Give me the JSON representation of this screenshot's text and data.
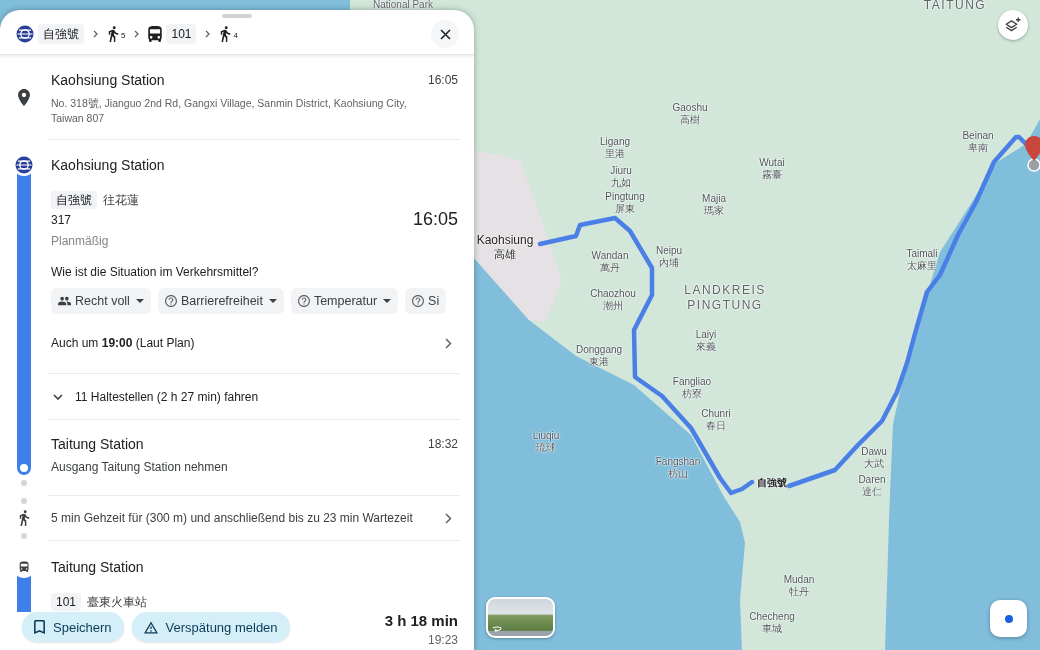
{
  "header": {
    "steps": [
      {
        "kind": "train",
        "label": "自強號"
      },
      {
        "kind": "walk",
        "minutes": "5"
      },
      {
        "kind": "bus",
        "label": "101"
      },
      {
        "kind": "walk",
        "minutes": "4"
      }
    ]
  },
  "origin": {
    "name": "Kaohsiung Station",
    "time": "16:05",
    "address": "No. 318號, Jianguo 2nd Rd, Gangxi Village, Sanmin District, Kaohsiung City, Taiwan 807"
  },
  "transit_leg": {
    "stop": "Kaohsiung Station",
    "line": "自強號",
    "direction": "往花蓮",
    "number": "317",
    "departure": "16:05",
    "status": "Planmäßig",
    "question": "Wie ist die Situation im Verkehrsmittel?",
    "chips": [
      {
        "kind": "crowd",
        "label": "Recht voll"
      },
      {
        "kind": "unknown",
        "label": "Barrierefreiheit"
      },
      {
        "kind": "unknown",
        "label": "Temperatur"
      },
      {
        "kind": "unknown",
        "label": "Si"
      }
    ],
    "alternative": "Auch um **19:00** (Laut Plan)",
    "stops_toggle": {
      "label": "11 Haltestellen (2 h 27 min) fahren",
      "expanded": false
    },
    "arrival": {
      "name": "Taitung Station",
      "time": "18:32",
      "note": "Ausgang Taitung Station nehmen"
    }
  },
  "walk_leg": {
    "text": "5 min Gehzeit für (300 m) und anschließend bis zu 23 min Wartezeit"
  },
  "bus_leg": {
    "stop": "Taitung Station",
    "line": "101",
    "direction": "臺東火車站"
  },
  "footer": {
    "buttons": [
      {
        "kind": "save",
        "label": "Speichern"
      },
      {
        "kind": "report",
        "label": "Verspätung melden"
      }
    ],
    "duration": "3 h 18 min",
    "arrival": "19:23"
  },
  "map": {
    "labels": [
      {
        "kind": "park",
        "name": "National Park"
      },
      {
        "kind": "region",
        "name": "TAITUNG"
      },
      {
        "kind": "town",
        "name": "Gaoshu",
        "local": "高樹"
      },
      {
        "kind": "town",
        "name": "Ligang",
        "local": "里港"
      },
      {
        "kind": "town",
        "name": "Beinan",
        "local": "卑南"
      },
      {
        "kind": "town",
        "name": "Jiuru",
        "local": "九如"
      },
      {
        "kind": "town",
        "name": "Wutai",
        "local": "霧臺"
      },
      {
        "kind": "town",
        "name": "Pingtung",
        "local": "屏東"
      },
      {
        "kind": "town",
        "name": "Majia",
        "local": "瑪家"
      },
      {
        "kind": "city",
        "name": "Kaohsiung",
        "local": "高雄"
      },
      {
        "kind": "town",
        "name": "Wandan",
        "local": "萬丹"
      },
      {
        "kind": "town",
        "name": "Neipu",
        "local": "內埔"
      },
      {
        "kind": "town",
        "name": "Taimali",
        "local": "太麻里"
      },
      {
        "kind": "town",
        "name": "Chaozhou",
        "local": "潮州"
      },
      {
        "kind": "region",
        "name": "LANDKREIS PINGTUNG"
      },
      {
        "kind": "town",
        "name": "Donggang",
        "local": "東港"
      },
      {
        "kind": "town",
        "name": "Laiyi",
        "local": "來義"
      },
      {
        "kind": "town",
        "name": "Fangliao",
        "local": "枋寮"
      },
      {
        "kind": "town",
        "name": "Liuqiu",
        "local": "琉球"
      },
      {
        "kind": "town",
        "name": "Chunri",
        "local": "春日"
      },
      {
        "kind": "town",
        "name": "Fangshan",
        "local": "枋山"
      },
      {
        "kind": "town",
        "name": "Dawu",
        "local": "大武"
      },
      {
        "kind": "town",
        "name": "Daren",
        "local": "達仁"
      },
      {
        "kind": "town",
        "name": "Mudan",
        "local": "牡丹"
      },
      {
        "kind": "town",
        "name": "Checheng",
        "local": "車城"
      }
    ],
    "route_label": "自強號"
  }
}
